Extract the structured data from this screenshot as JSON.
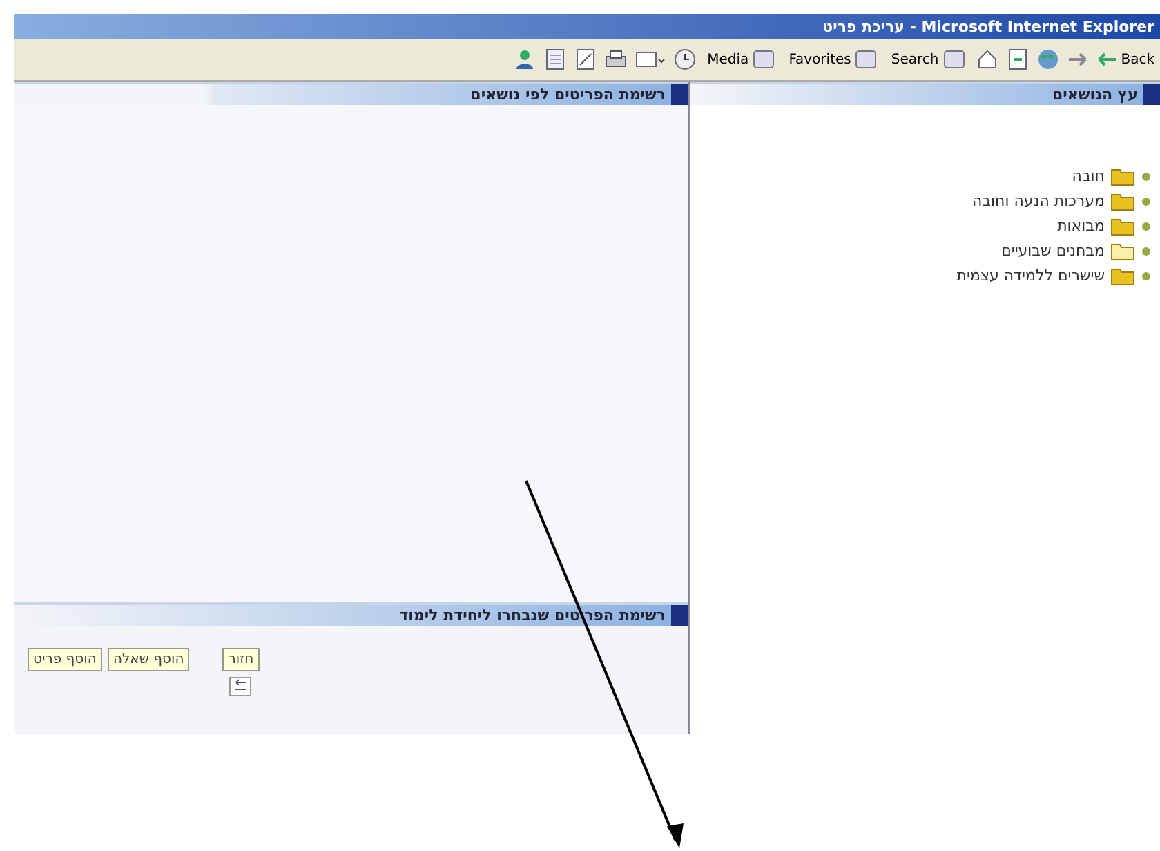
{
  "window": {
    "title": "עריכת פריט - Microsoft Internet Explorer"
  },
  "toolbar": {
    "items": [
      {
        "kind": "nav",
        "label": "Back"
      },
      {
        "kind": "arrow"
      },
      {
        "kind": "globe"
      },
      {
        "kind": "refresh"
      },
      {
        "kind": "home"
      },
      {
        "kind": "labeled",
        "label": "Search"
      },
      {
        "kind": "labeled",
        "label": "Favorites"
      },
      {
        "kind": "labeled",
        "label": "Media"
      },
      {
        "kind": "history"
      },
      {
        "kind": "mail"
      },
      {
        "kind": "print"
      },
      {
        "kind": "edit"
      },
      {
        "kind": "discuss"
      },
      {
        "kind": "messenger"
      }
    ]
  },
  "topic_tree": {
    "title": "עץ הנושאים",
    "items": [
      {
        "label": "חובה",
        "dimmed": false
      },
      {
        "label": "מערכות הנעה וחובה",
        "dimmed": false
      },
      {
        "label": "מבואות",
        "dimmed": false
      },
      {
        "label": "מבחנים שבועיים",
        "dimmed": true
      },
      {
        "label": "שישרים ללמידה עצמית",
        "dimmed": false
      }
    ]
  },
  "items_by_topic": {
    "title": "רשימת הפריטים לפי נושאים"
  },
  "selected_items": {
    "title": "רשימת הפריטים שנבחרו ליחידת לימוד"
  },
  "buttons": [
    "חזור",
    "הוסף שאלה",
    "הוסף פריט"
  ]
}
